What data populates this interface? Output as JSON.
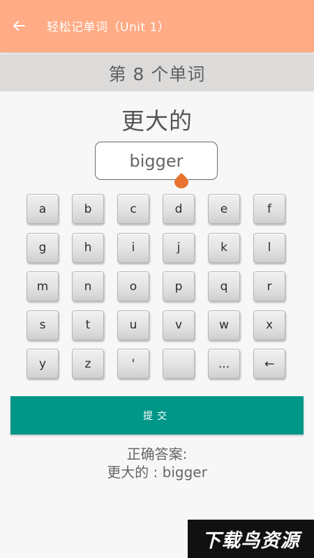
{
  "appbar": {
    "title": "轻松记单词（Unit 1）",
    "back_icon": "arrow-left-icon",
    "background": "#ffab85"
  },
  "progress": {
    "label": "第 8 个单词"
  },
  "question": {
    "word": "更大的"
  },
  "answer_input": {
    "value": "bigger",
    "cursor_color": "#e8732e"
  },
  "keyboard": {
    "rows": [
      [
        "a",
        "b",
        "c",
        "d",
        "e",
        "f"
      ],
      [
        "g",
        "h",
        "i",
        "j",
        "k",
        "l"
      ],
      [
        "m",
        "n",
        "o",
        "p",
        "q",
        "r"
      ],
      [
        "s",
        "t",
        "u",
        "v",
        "w",
        "x"
      ],
      [
        "y",
        "z",
        "'",
        "",
        "...",
        "←"
      ]
    ]
  },
  "submit": {
    "label": "提交",
    "color": "#009688"
  },
  "result": {
    "label": "正确答案:",
    "value": "更大的 : bigger"
  },
  "watermark": {
    "text": "下载鸟资源"
  }
}
